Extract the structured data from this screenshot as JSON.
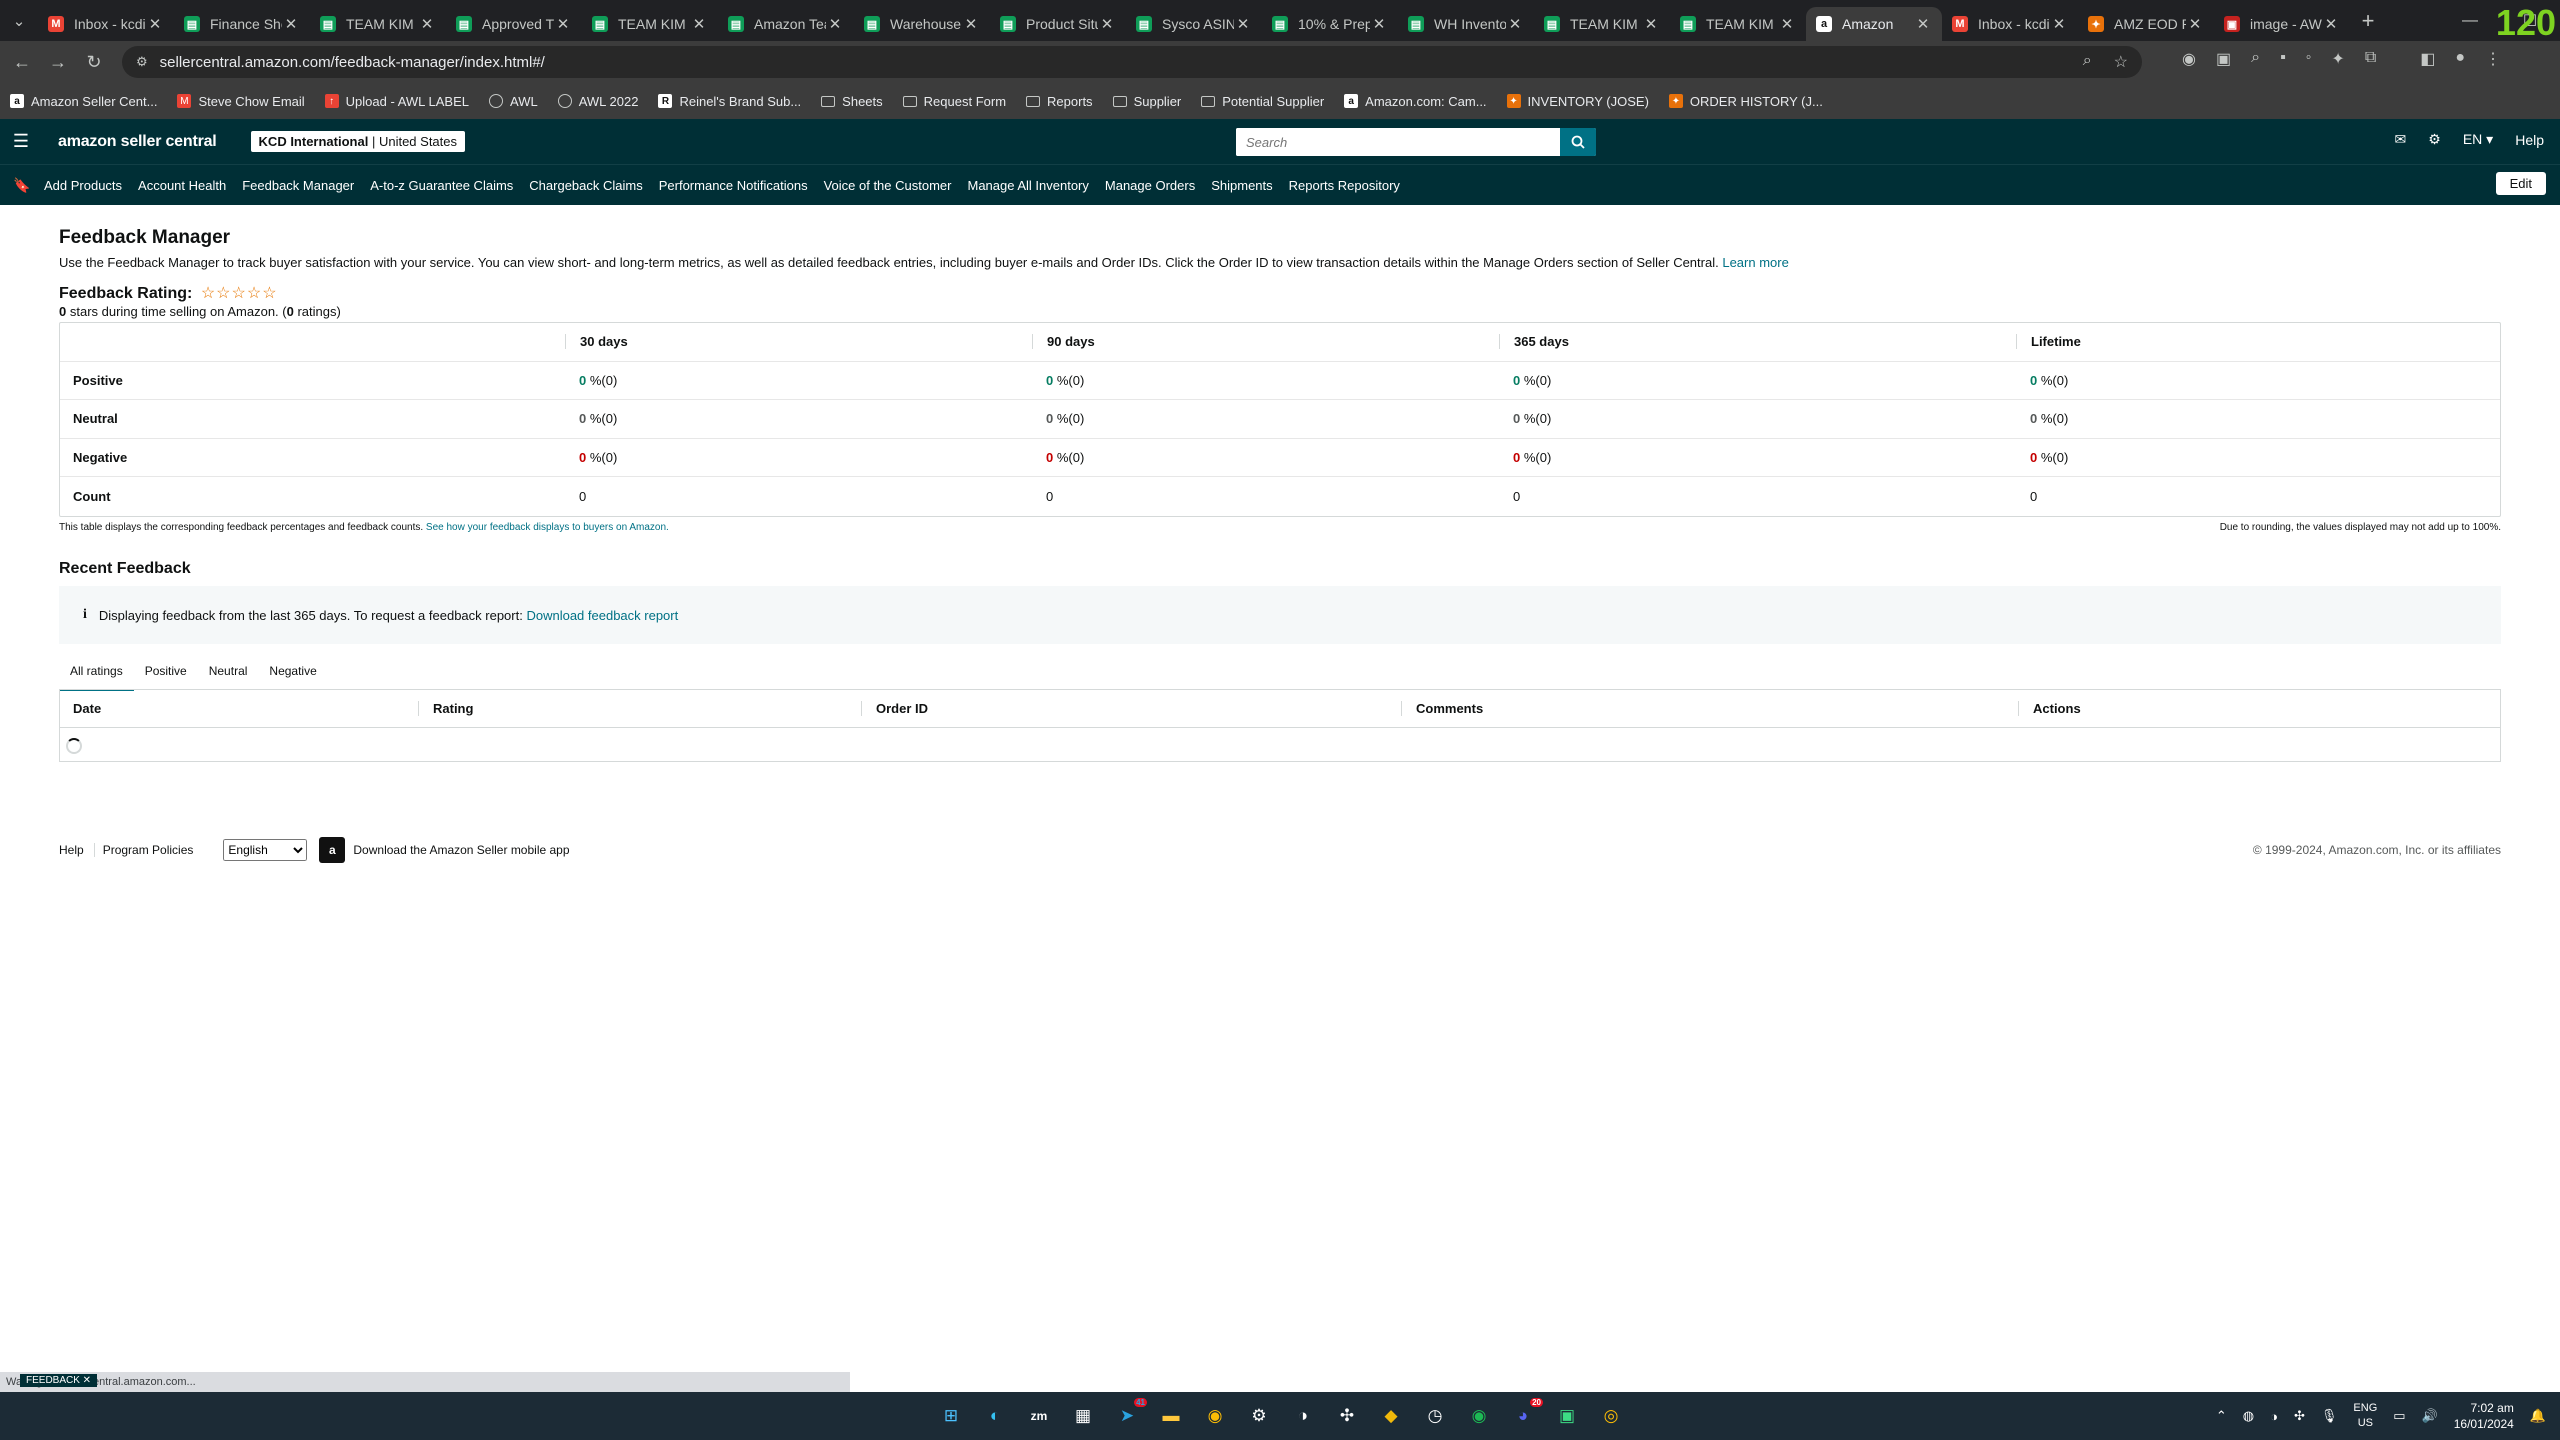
{
  "browser": {
    "tabs": [
      {
        "label": "Inbox - kcdi",
        "icon": "gmail-icon"
      },
      {
        "label": "Finance She",
        "icon": "sheets-icon"
      },
      {
        "label": "TEAM KIM - I",
        "icon": "sheets-icon"
      },
      {
        "label": "Approved Ti",
        "icon": "sheets-icon"
      },
      {
        "label": "TEAM KIM S",
        "icon": "sheets-icon"
      },
      {
        "label": "Amazon Tea",
        "icon": "sheets-icon"
      },
      {
        "label": "Warehouse",
        "icon": "sheets-icon"
      },
      {
        "label": "Product Situ",
        "icon": "sheets-icon"
      },
      {
        "label": "Sysco ASIN",
        "icon": "sheets-icon"
      },
      {
        "label": "10% & Prep",
        "icon": "sheets-icon"
      },
      {
        "label": "WH Invento",
        "icon": "sheets-icon"
      },
      {
        "label": "TEAM KIM I",
        "icon": "sheets-icon"
      },
      {
        "label": "TEAM KIM I",
        "icon": "sheets-icon"
      },
      {
        "label": "Amazon",
        "icon": "amazon-icon",
        "active": true
      },
      {
        "label": "Inbox - kcdi",
        "icon": "gmail-icon"
      },
      {
        "label": "AMZ EOD R",
        "icon": "extension-icon"
      },
      {
        "label": "image - AW",
        "icon": "image-icon"
      }
    ],
    "url": "sellercentral.amazon.com/feedback-manager/index.html#/",
    "counter": "120",
    "bookmarks": [
      {
        "label": "Amazon Seller Cent...",
        "icon": "amazon-icon"
      },
      {
        "label": "Steve Chow Email",
        "icon": "gmail-icon"
      },
      {
        "label": "Upload - AWL LABEL",
        "icon": "upload-icon"
      },
      {
        "label": "AWL",
        "icon": "globe-icon"
      },
      {
        "label": "AWL 2022",
        "icon": "globe-icon"
      },
      {
        "label": "Reinel's Brand Sub...",
        "icon": "brand-icon"
      },
      {
        "label": "Sheets",
        "icon": "folder-icon"
      },
      {
        "label": "Request Form",
        "icon": "folder-icon"
      },
      {
        "label": "Reports",
        "icon": "folder-icon"
      },
      {
        "label": "Supplier",
        "icon": "folder-icon"
      },
      {
        "label": "Potential Supplier",
        "icon": "folder-icon"
      },
      {
        "label": "Amazon.com: Cam...",
        "icon": "amazon-icon"
      },
      {
        "label": "INVENTORY (JOSE)",
        "icon": "order-icon"
      },
      {
        "label": "ORDER HISTORY (J...",
        "icon": "order-icon"
      }
    ]
  },
  "header": {
    "logo": "amazon seller central",
    "account_name": "KCD International",
    "account_region": "United States",
    "search_placeholder": "Search",
    "language": "EN",
    "help": "Help"
  },
  "nav": {
    "items": [
      "Add Products",
      "Account Health",
      "Feedback Manager",
      "A-to-z Guarantee Claims",
      "Chargeback Claims",
      "Performance Notifications",
      "Voice of the Customer",
      "Manage All Inventory",
      "Manage Orders",
      "Shipments",
      "Reports Repository"
    ],
    "edit": "Edit"
  },
  "page": {
    "title": "Feedback Manager",
    "description": "Use the Feedback Manager to track buyer satisfaction with your service. You can view short- and long-term metrics, as well as detailed feedback entries, including buyer e-mails and Order IDs. Click the Order ID to view transaction details within the Manage Orders section of Seller Central.",
    "learn_more": "Learn more",
    "rating_label": "Feedback Rating:",
    "rating_stars": "☆☆☆☆☆",
    "rating_stars_value": 0,
    "rating_value": "0",
    "rating_sub_mid": " stars during time selling on Amazon. (",
    "rating_count": "0",
    "rating_sub_end": " ratings)"
  },
  "feedback_table": {
    "columns": [
      "",
      "30 days",
      "90 days",
      "365 days",
      "Lifetime"
    ],
    "rows": [
      {
        "label": "Positive",
        "values": [
          "0",
          "0",
          "0",
          "0"
        ],
        "suffix": " %(0)"
      },
      {
        "label": "Neutral",
        "values": [
          "0",
          "0",
          "0",
          "0"
        ],
        "suffix": " %(0)"
      },
      {
        "label": "Negative",
        "values": [
          "0",
          "0",
          "0",
          "0"
        ],
        "suffix": " %(0)"
      },
      {
        "label": "Count",
        "values": [
          "0",
          "0",
          "0",
          "0"
        ],
        "suffix": ""
      }
    ],
    "note": "This table displays the corresponding feedback percentages and feedback counts.",
    "note_link": "See how your feedback displays to buyers on Amazon.",
    "rounding_note": "Due to rounding, the values displayed may not add up to 100%."
  },
  "recent": {
    "title": "Recent Feedback",
    "info": "Displaying feedback from the last 365 days. To request a feedback report:",
    "info_link": "Download feedback report",
    "tabs": [
      "All ratings",
      "Positive",
      "Neutral",
      "Negative"
    ],
    "columns": [
      "Date",
      "Rating",
      "Order ID",
      "Comments",
      "Actions"
    ]
  },
  "footer": {
    "help": "Help",
    "policies": "Program Policies",
    "language": "English",
    "app": "Download the Amazon Seller mobile app",
    "copyright": "© 1999-2024, Amazon.com, Inc. or its affiliates"
  },
  "status": {
    "text": "Waiting for sellercentral.amazon.com...",
    "feedback": "FEEDBACK"
  },
  "taskbar": {
    "lang": "ENG",
    "region": "US",
    "time": "7:02 am",
    "date": "16/01/2024",
    "telegram_badge": "41",
    "discord_badge": "20"
  }
}
